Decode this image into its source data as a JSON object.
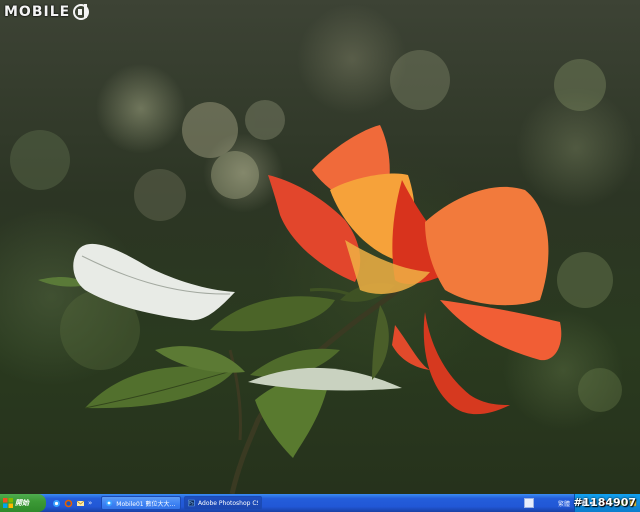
{
  "wallpaper": {
    "watermark_text": "MOBILE",
    "photo_id": "#1184907",
    "colors": {
      "bokeh_background": "#2c3524",
      "petal_orange": "#f2743a",
      "petal_red": "#d8331d",
      "leaf_green": "#4c6a2c"
    }
  },
  "taskbar": {
    "start_label": "開始",
    "quick_launch_icons": [
      "ie-icon",
      "firefox-icon",
      "outlook-icon"
    ],
    "quick_launch_more": "»",
    "tasks": [
      {
        "label": "Mobile01 數位大大...",
        "icon": "ie-icon",
        "active": false
      },
      {
        "label": "Adobe Photoshop CS3...",
        "icon": "photoshop-icon",
        "active": true
      }
    ],
    "language_label": "繁體",
    "tray_icons": [
      "network-icon",
      "volume-icon",
      "security-icon",
      "messenger-icon",
      "msn-icon",
      "antivirus-icon"
    ],
    "colors": {
      "taskbar_blue": "#245edb",
      "start_green": "#3c9a36",
      "tray_blue": "#0f8ee0"
    }
  }
}
